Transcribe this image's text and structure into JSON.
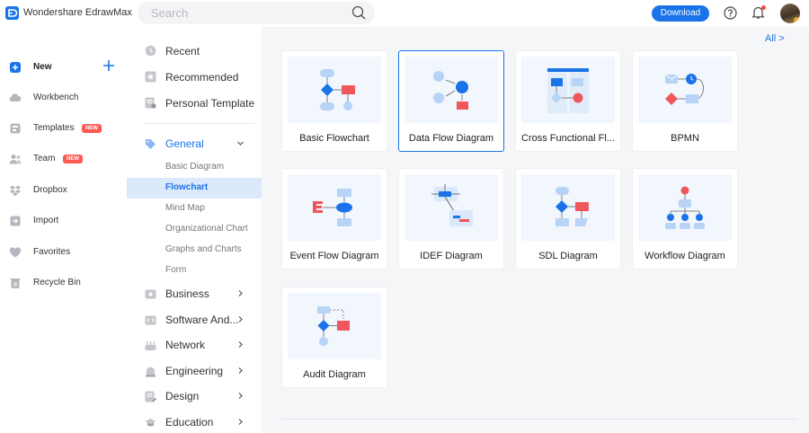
{
  "app": {
    "title": "Wondershare EdrawMax"
  },
  "search": {
    "placeholder": "Search"
  },
  "header": {
    "download_label": "Download"
  },
  "left_nav": {
    "items": [
      {
        "label": "New",
        "icon": "new-icon"
      },
      {
        "label": "Workbench",
        "icon": "cloud-icon"
      },
      {
        "label": "Templates",
        "icon": "templates-icon",
        "badge": "NEW"
      },
      {
        "label": "Team",
        "icon": "team-icon",
        "badge": "NEW"
      },
      {
        "label": "Dropbox",
        "icon": "dropbox-icon"
      },
      {
        "label": "Import",
        "icon": "import-icon"
      },
      {
        "label": "Favorites",
        "icon": "heart-icon"
      },
      {
        "label": "Recycle Bin",
        "icon": "trash-icon"
      }
    ]
  },
  "categories": {
    "top": [
      {
        "label": "Recent",
        "icon": "clock-icon"
      },
      {
        "label": "Recommended",
        "icon": "star-icon"
      },
      {
        "label": "Personal Template",
        "icon": "personal-template-icon"
      }
    ],
    "general": {
      "label": "General",
      "sub": [
        "Basic Diagram",
        "Flowchart",
        "Mind Map",
        "Organizational Chart",
        "Graphs and Charts",
        "Form"
      ],
      "active_sub": "Flowchart"
    },
    "groups": [
      {
        "label": "Business",
        "icon": "business-icon"
      },
      {
        "label": "Software And...",
        "icon": "software-icon"
      },
      {
        "label": "Network",
        "icon": "network-icon"
      },
      {
        "label": "Engineering",
        "icon": "engineering-icon"
      },
      {
        "label": "Design",
        "icon": "design-icon"
      },
      {
        "label": "Education",
        "icon": "education-icon"
      }
    ]
  },
  "main": {
    "all_label": "All >",
    "templates": [
      {
        "label": "Basic Flowchart"
      },
      {
        "label": "Data Flow Diagram",
        "selected": true
      },
      {
        "label": "Cross Functional Fl..."
      },
      {
        "label": "BPMN"
      },
      {
        "label": "Event Flow Diagram"
      },
      {
        "label": "IDEF Diagram"
      },
      {
        "label": "SDL Diagram"
      },
      {
        "label": "Workflow Diagram"
      },
      {
        "label": "Audit Diagram"
      }
    ]
  },
  "colors": {
    "accent": "#1a73e8",
    "badge": "#ff5a52",
    "shape_blue": "#1a73e8",
    "shape_light": "#b7d4f7",
    "shape_red": "#f0575c"
  }
}
